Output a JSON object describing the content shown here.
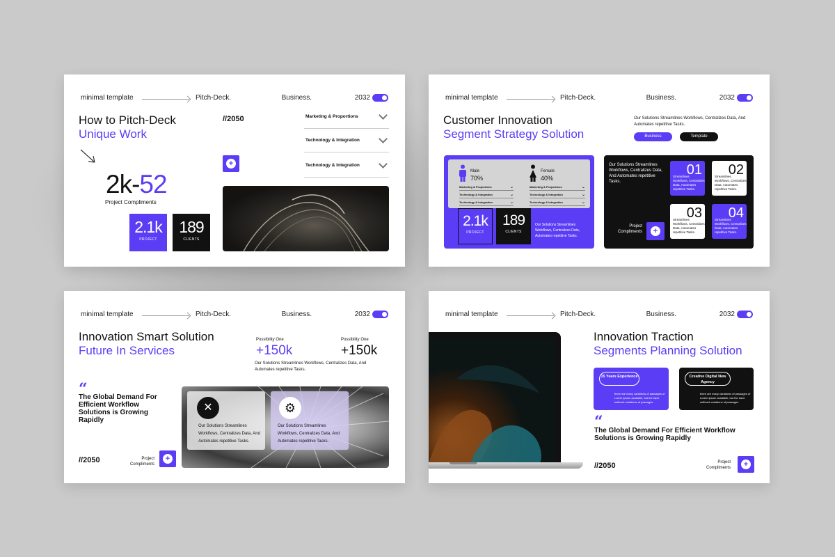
{
  "colors": {
    "accent": "#5b3df5",
    "dark": "#111111",
    "background": "#cacaca"
  },
  "topbar": {
    "left": "minimal template",
    "middle": "Pitch-Deck.",
    "business": "Business.",
    "year": "2032"
  },
  "slide1": {
    "title": "How to Pitch-Deck",
    "title_accent": "Unique Work",
    "tag": "//2050",
    "big_left": "2k-",
    "big_right": "52",
    "big_caption": "Project Compliments",
    "stat1": {
      "value": "2.1k",
      "label": "PROJECT"
    },
    "stat2": {
      "value": "189",
      "label": "CLIENTS"
    },
    "accordion": [
      "Marketing & Proportions",
      "Technology & Integration",
      "Technology & Integration"
    ]
  },
  "slide2": {
    "title": "Customer Innovation",
    "title_accent": "Segment Strategy Solution",
    "desc": "Our Solutions Streamlines Workflows, Centralizes Data, And Automates repetitive Tasks.",
    "pills": [
      "Business",
      "Template"
    ],
    "male": {
      "label": "Male",
      "pct": "70%"
    },
    "female": {
      "label": "Female",
      "pct": "40%"
    },
    "rows": [
      "Marketing & Proportions",
      "Technology & Integration",
      "Technology & Integration"
    ],
    "stat1": {
      "value": "2.1k",
      "label": "PROJECT"
    },
    "stat2": {
      "value": "189",
      "label": "CLIENTS"
    },
    "panel_desc": "Our Solutions Streamlines Workflows, Centralizes Data, Automates repetitive Tasks.",
    "dark_desc": "Our Solutions Streamlines Workflows, Centralizes Data, And Automates repetitive Tasks.",
    "dark_caption": "Project Compliments",
    "cards": [
      {
        "n": "01",
        "d": "Streamlines Workflows, Centralizes Data, Automates repetitive Tasks."
      },
      {
        "n": "02",
        "d": "Streamlines Workflows, Centralizes Data, Automates repetitive Tasks."
      },
      {
        "n": "03",
        "d": "Streamlines Workflows, Centralizes Data, Automates repetitive Tasks."
      },
      {
        "n": "04",
        "d": "Streamlines Workflows, Centralizes Data, Automates repetitive Tasks."
      }
    ]
  },
  "slide3": {
    "title": "Innovation Smart Solution",
    "title_accent": "Future In Services",
    "poss1_label": "Possibility One",
    "poss1_value": "+150k",
    "poss2_label": "Possibility One",
    "poss2_value": "+150k",
    "desc": "Our Solutions Streamlines Workflows, Centralizes Data, And Automates repetitive Tasks.",
    "quote_text": "The Global Demand For Efficient Workflow Solutions is Growing Rapidly",
    "tag": "//2050",
    "caption": "Project Compliments",
    "card1": "Our Solutions Streamlines Workflows, Centralizes Data, And Automates repetitive Tasks.",
    "card2": "Our Solutions Streamlines Workflows, Centralizes Data, And Automates repetitive Tasks."
  },
  "slide4": {
    "title": "Innovation Traction",
    "title_accent": "Segments Planning Solution",
    "card1_title": "15 Years Experience",
    "card1_desc": "there are many variations of passages of Lorem Ipsum available, but the have suffered variations of passages",
    "card2_title": "Creative Digital New Agency",
    "card2_desc": "there are many variations of passages of Lorem Ipsum available, but the have suffered variations of passages",
    "quote_text": "The Global Demand For Efficient Workflow Solutions is Growing Rapidly",
    "tag": "//2050",
    "caption": "Project Compliments"
  }
}
